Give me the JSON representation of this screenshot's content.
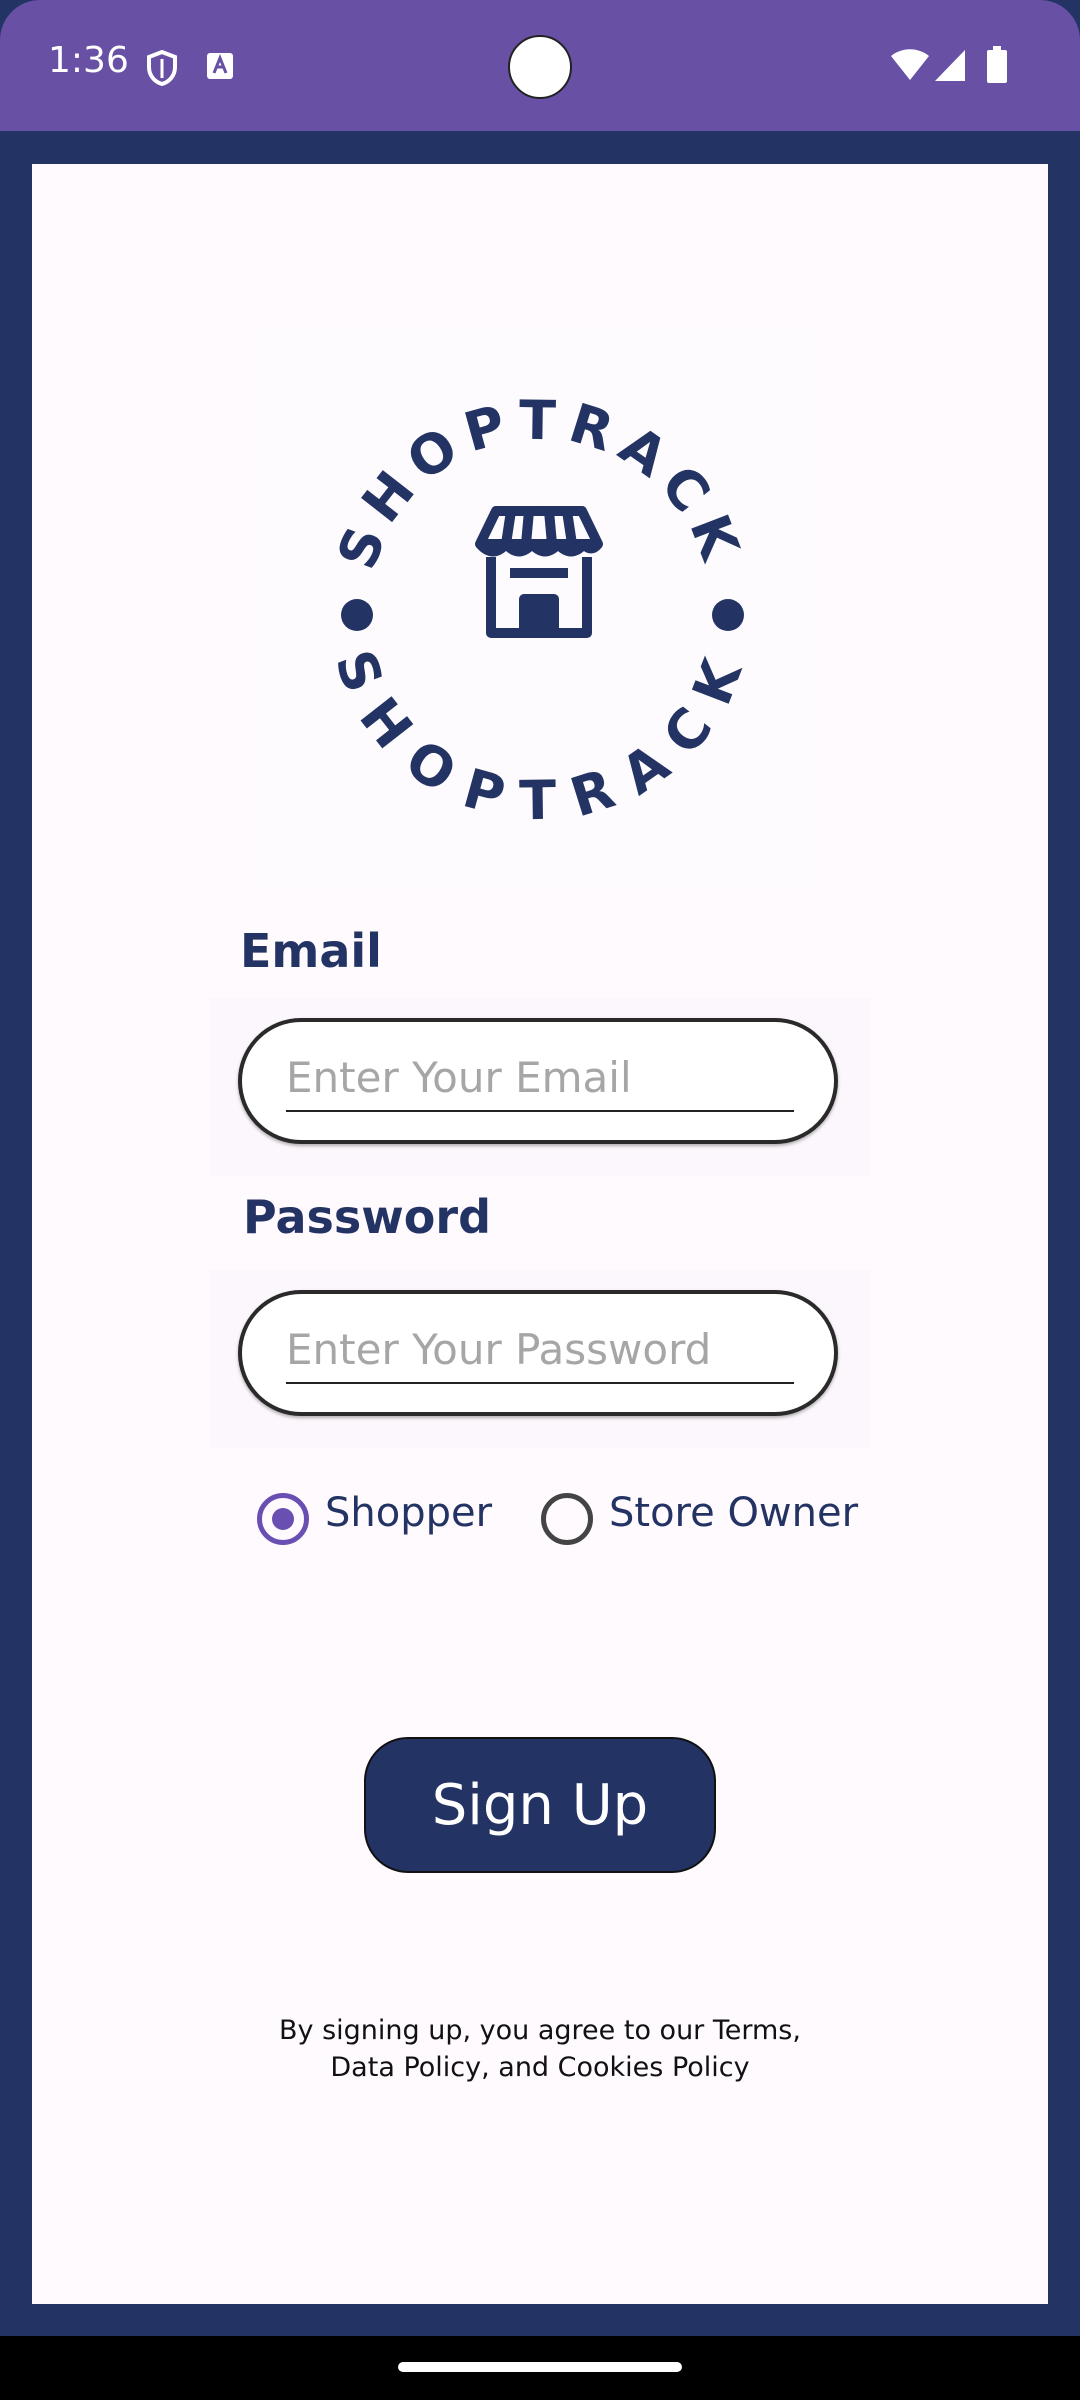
{
  "status_bar": {
    "time": "1:36",
    "icons": [
      "shield-icon",
      "text-a-icon",
      "wifi-icon",
      "signal-icon",
      "battery-icon"
    ]
  },
  "logo": {
    "brand_text": "SHOPTRACK",
    "icon": "storefront-icon"
  },
  "form": {
    "email": {
      "label": "Email",
      "value": "",
      "placeholder": "Enter Your Email"
    },
    "password": {
      "label": "Password",
      "value": "",
      "placeholder": "Enter Your Password"
    },
    "role": {
      "options": [
        {
          "label": "Shopper",
          "selected": true
        },
        {
          "label": "Store Owner",
          "selected": false
        }
      ]
    },
    "submit_label": "Sign Up"
  },
  "footer": {
    "terms_line1": "By signing up, you agree to our Terms,",
    "terms_line2": "Data Policy, and Cookies Policy"
  },
  "colors": {
    "status_bar": "#6851a5",
    "brand_navy": "#233363",
    "accent_purple": "#6a4fb3",
    "card_bg": "#fefafe"
  }
}
